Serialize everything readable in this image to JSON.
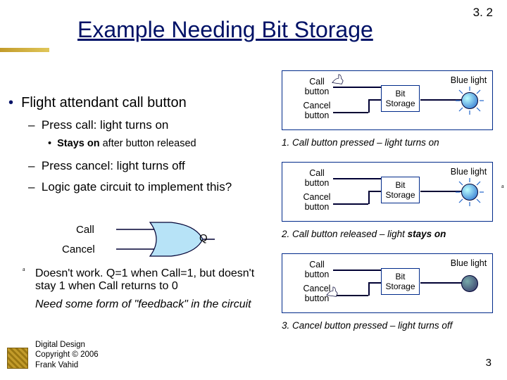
{
  "page_num_top": "3. 2",
  "title": "Example Needing Bit Storage",
  "bullets": {
    "b1": "Flight attendant call button",
    "b2a": "Press call: light turns on",
    "b3a_prefix": "Stays on",
    "b3a_suffix": " after button released",
    "b2b": "Press cancel: light turns off",
    "b2c": "Logic gate circuit to implement this?"
  },
  "gate": {
    "call": "Call",
    "cancel": "Cancel",
    "q": "Q"
  },
  "fail_line1": "Doesn't work. Q=1 when Call=1, but doesn't stay 1 when Call returns to 0",
  "fail_line2": "Need some form of \"feedback\" in the circuit",
  "tiny_a": "a",
  "diagram": {
    "call": "Call button",
    "cancel": "Cancel button",
    "bit": "Bit Storage",
    "blue": "Blue light"
  },
  "captions": {
    "c1": "1. Call button pressed – light turns on",
    "c2_prefix": "2. Call button released – light ",
    "c2_bold": "stays on",
    "c3": "3. Cancel button pressed – light turns off"
  },
  "footer": {
    "l1": "Digital Design",
    "l2": "Copyright © 2006",
    "l3": "Frank Vahid"
  },
  "slide_num": "3"
}
